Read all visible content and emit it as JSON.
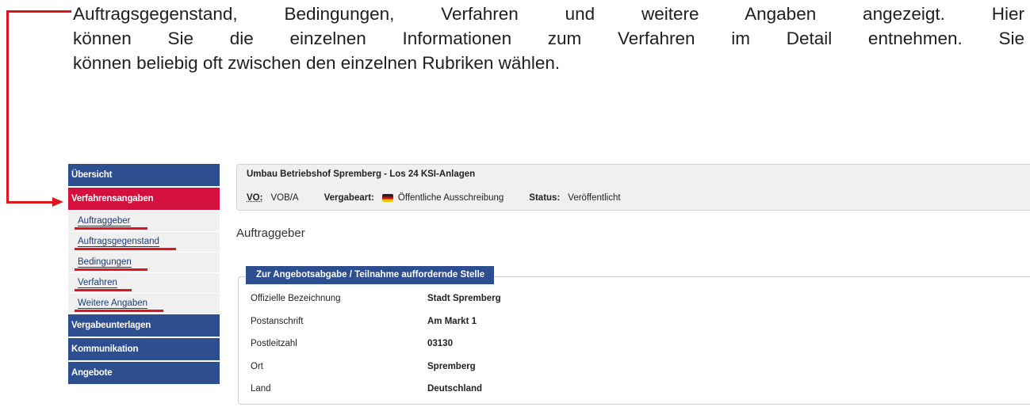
{
  "intro": {
    "line1": "Auftragsgegenstand, Bedingungen, Verfahren und weitere Angaben angezeigt. Hier",
    "line2": "können Sie die einzelnen Informationen zum Verfahren im Detail entnehmen. Sie",
    "line3": "können beliebig oft zwischen den einzelnen Rubriken wählen."
  },
  "colors": {
    "nav_blue": "#2e4f8f",
    "nav_active": "#d3103e",
    "annotation_red": "#e0141e"
  },
  "sidebar": {
    "overview": "Übersicht",
    "active": "Verfahrensangaben",
    "subitems": [
      "Auftraggeber",
      "Auftragsgegenstand",
      "Bedingungen",
      "Verfahren",
      "Weitere Angaben"
    ],
    "tender_docs": "Vergabeunterlagen",
    "communication": "Kommunikation",
    "offers": "Angebote"
  },
  "header": {
    "title": "Umbau Betriebshof Spremberg - Los 24 KSI-Anlagen",
    "vo_label": "VO:",
    "vo_value": "VOB/A",
    "award_label": "Vergabeart:",
    "award_value": "Öffentliche Ausschreibung",
    "status_label": "Status:",
    "status_value": "Veröffentlicht"
  },
  "section_title": "Auftraggeber",
  "fieldset": {
    "legend": "Zur Angebotsabgabe / Teilnahme auffordernde Stelle",
    "rows": [
      {
        "key": "Offizielle Bezeichnung",
        "value": "Stadt Spremberg"
      },
      {
        "key": "Postanschrift",
        "value": "Am Markt 1"
      },
      {
        "key": "Postleitzahl",
        "value": "03130"
      },
      {
        "key": "Ort",
        "value": "Spremberg"
      },
      {
        "key": "Land",
        "value": "Deutschland"
      }
    ]
  }
}
